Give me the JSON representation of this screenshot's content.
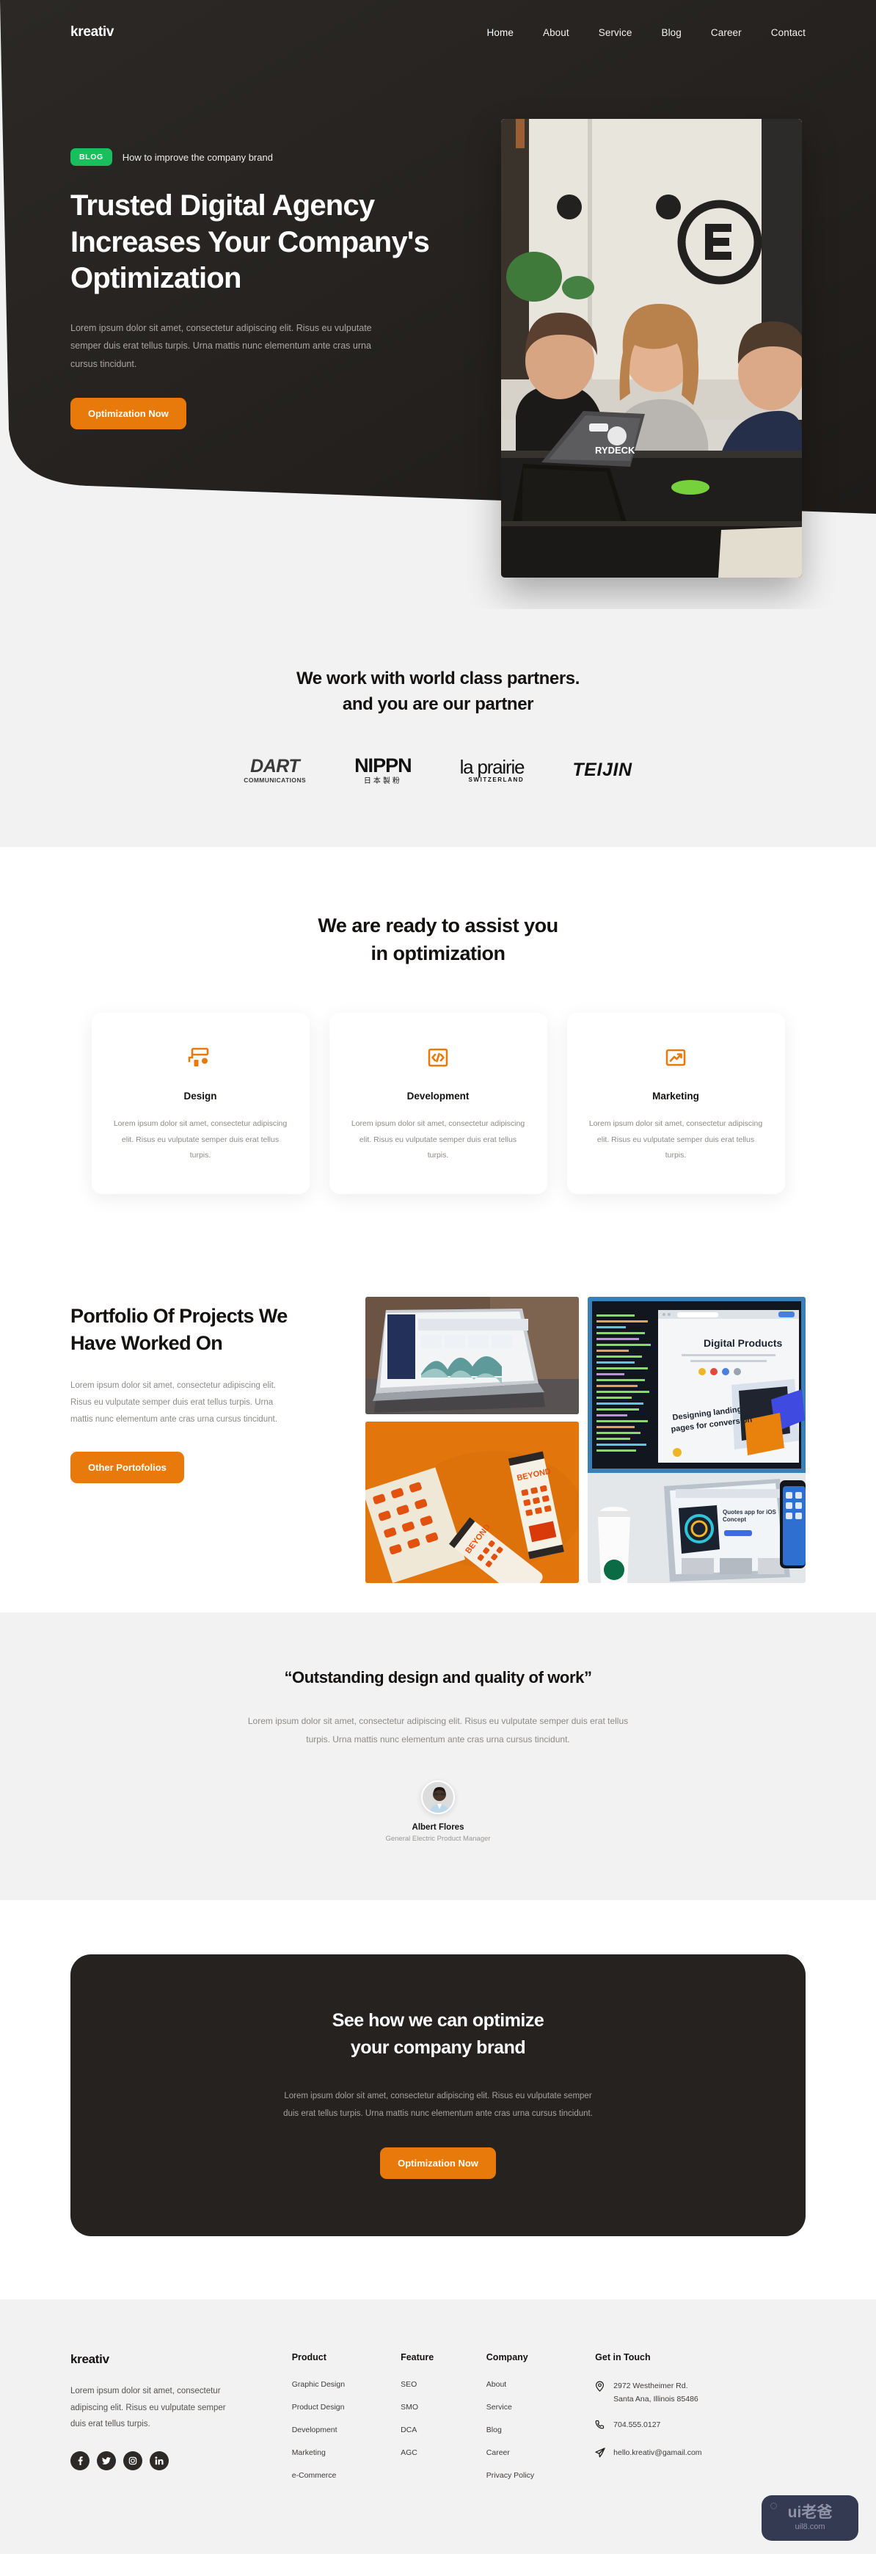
{
  "nav": {
    "logo": "kreativ",
    "links": [
      {
        "label": "Home"
      },
      {
        "label": "About"
      },
      {
        "label": "Service"
      },
      {
        "label": "Blog"
      },
      {
        "label": "Career"
      },
      {
        "label": "Contact"
      }
    ]
  },
  "hero": {
    "badge": "BLOG",
    "badge_color": "#19bf5c",
    "caption": "How to improve the company brand",
    "title": "Trusted Digital Agency Increases Your Company's Optimization",
    "description": "Lorem ipsum dolor sit amet, consectetur adipiscing elit. Risus eu vulputate semper duis erat tellus turpis. Urna mattis nunc elementum ante cras urna cursus tincidunt.",
    "cta_label": "Optimization Now",
    "accent_color": "#e87a0c",
    "image_alt": "team of three colleagues reviewing laptops at a dark office table"
  },
  "partners": {
    "heading_line1": "We work with world class partners.",
    "heading_line2": "and you are our partner",
    "logos": [
      {
        "name": "DART",
        "sub": "COMMUNICATIONS"
      },
      {
        "name": "NIPPN",
        "sub": "日本製粉"
      },
      {
        "name": "la prairie",
        "sub": "SWITZERLAND"
      },
      {
        "name": "TEIJIN",
        "sub": ""
      }
    ]
  },
  "services": {
    "heading_line1": "We are ready to assist you",
    "heading_line2": "in optimization",
    "cards": [
      {
        "icon": "paint-roller-icon",
        "title": "Design",
        "text": "Lorem ipsum dolor sit amet, consectetur adipiscing elit. Risus eu vulputate semper duis erat tellus turpis."
      },
      {
        "icon": "code-icon",
        "title": "Development",
        "text": "Lorem ipsum dolor sit amet, consectetur adipiscing elit. Risus eu vulputate semper duis erat tellus turpis."
      },
      {
        "icon": "trending-up-icon",
        "title": "Marketing",
        "text": "Lorem ipsum dolor sit amet, consectetur adipiscing elit. Risus eu vulputate semper duis erat tellus turpis."
      }
    ]
  },
  "portfolio": {
    "title": "Portfolio Of Projects We Have Worked On",
    "description": "Lorem ipsum dolor sit amet, consectetur adipiscing elit. Risus eu vulputate semper duis erat tellus turpis. Urna mattis nunc elementum ante cras urna cursus tincidunt.",
    "cta_label": "Other Portofolios",
    "images": [
      {
        "alt": "laptop showing an analytics dashboard with area charts"
      },
      {
        "alt": "orange branded drink cans and patterned packaging"
      },
      {
        "alt": "desktop monitor with code editor and a tablet showing a product page"
      }
    ]
  },
  "testimonial": {
    "quote": "“Outstanding design and quality of work”",
    "body": "Lorem ipsum dolor sit amet, consectetur adipiscing elit. Risus eu vulputate semper duis erat tellus turpis. Urna mattis nunc elementum ante cras urna cursus tincidunt.",
    "author": "Albert Flores",
    "role": "General Electric Product Manager"
  },
  "cta": {
    "heading_line1": "See how we can optimize",
    "heading_line2": "your company brand",
    "body": "Lorem ipsum dolor sit amet, consectetur adipiscing elit. Risus eu vulputate semper duis erat tellus turpis. Urna mattis nunc elementum ante cras urna cursus tincidunt.",
    "button_label": "Optimization Now"
  },
  "footer": {
    "logo": "kreativ",
    "about": "Lorem ipsum dolor sit amet, consectetur adipiscing elit. Risus eu vulputate semper duis erat tellus turpis.",
    "socials": [
      "facebook-icon",
      "twitter-icon",
      "instagram-icon",
      "linkedin-icon"
    ],
    "columns": [
      {
        "title": "Product",
        "links": [
          "Graphic  Design",
          "Product Design",
          "Development",
          "Marketing",
          "e-Commerce"
        ]
      },
      {
        "title": "Feature",
        "links": [
          "SEO",
          "SMO",
          "DCA",
          "AGC"
        ]
      },
      {
        "title": "Company",
        "links": [
          "About",
          "Service",
          "Blog",
          "Career",
          "Privacy Policy"
        ]
      }
    ],
    "contact": {
      "title": "Get in Touch",
      "address_line1": "2972 Westheimer Rd.",
      "address_line2": "Santa Ana, Illinois 85486",
      "phone": "704.555.0127",
      "email": "hello.kreativ@gamail.com"
    }
  },
  "watermark": {
    "main": "ui老爸",
    "sub": "uil8.com"
  }
}
